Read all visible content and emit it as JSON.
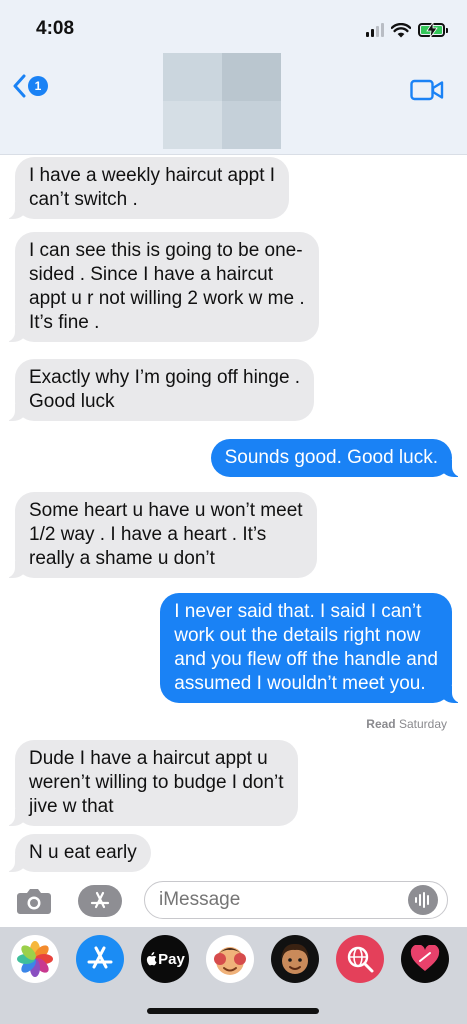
{
  "status_bar": {
    "time": "4:08"
  },
  "header": {
    "unread_count": "1"
  },
  "messages": [
    {
      "side": "received",
      "text": "I have a weekly haircut appt I\ncan’t switch ."
    },
    {
      "side": "received",
      "text": "I can see this is going to be one-\nsided . Since I have a haircut\nappt u r not willing 2 work w me .\nIt’s fine ."
    },
    {
      "side": "received",
      "text": "Exactly why I’m going off hinge .\nGood luck"
    },
    {
      "side": "sent",
      "text": "Sounds good. Good luck."
    },
    {
      "side": "received",
      "text": "Some heart u have u won’t meet\n1/2 way . I have a heart . It’s\nreally a shame u don’t"
    },
    {
      "side": "sent",
      "text": "I never said that. I said I can’t\nwork out the details right now\nand you flew off the handle and\nassumed I wouldn’t meet you."
    },
    {
      "side": "received",
      "text": "Dude I have a haircut appt u\nweren’t willing to budge I don’t\njive w that"
    },
    {
      "side": "received",
      "text": "N u eat early"
    }
  ],
  "read_receipt": {
    "label": "Read",
    "day": "Saturday"
  },
  "input": {
    "placeholder": "iMessage"
  },
  "app_drawer": {
    "apple_pay_label": "Pay",
    "apps": [
      "photos-app",
      "app-store-app",
      "apple-pay-app",
      "memoji-stickers-app",
      "memoji-app",
      "image-search-app",
      "digital-touch-app"
    ]
  },
  "colors": {
    "sent_bubble": "#1a82f5",
    "received_bubble": "#e9e9eb",
    "header_bg": "#ecf1f8",
    "drawer_bg": "#d2d5db"
  }
}
